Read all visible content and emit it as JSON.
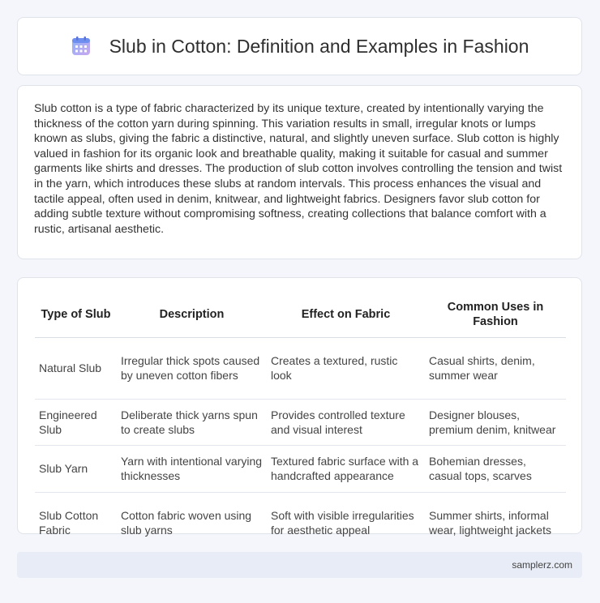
{
  "header": {
    "title": "Slub in Cotton: Definition and Examples in Fashion",
    "icon": "calendar-icon",
    "icon_colors": [
      "#8fb3f7",
      "#c9a7f0"
    ]
  },
  "intro": {
    "text": "Slub cotton is a type of fabric characterized by its unique texture, created by intentionally varying the thickness of the cotton yarn during spinning. This variation results in small, irregular knots or lumps known as slubs, giving the fabric a distinctive, natural, and slightly uneven surface. Slub cotton is highly valued in fashion for its organic look and breathable quality, making it suitable for casual and summer garments like shirts and dresses. The production of slub cotton involves controlling the tension and twist in the yarn, which introduces these slubs at random intervals. This process enhances the visual and tactile appeal, often used in denim, knitwear, and lightweight fabrics. Designers favor slub cotton for adding subtle texture without compromising softness, creating collections that balance comfort with a rustic, artisanal aesthetic."
  },
  "table": {
    "headers": [
      "Type of Slub",
      "Description",
      "Effect on Fabric",
      "Common Uses in Fashion"
    ],
    "rows": [
      [
        "Natural Slub",
        "Irregular thick spots caused by uneven cotton fibers",
        "Creates a textured, rustic look",
        "Casual shirts, denim, summer wear"
      ],
      [
        "Engineered Slub",
        "Deliberate thick yarns spun to create slubs",
        "Provides controlled texture and visual interest",
        "Designer blouses, premium denim, knitwear"
      ],
      [
        "Slub Yarn",
        "Yarn with intentional varying thicknesses",
        "Textured fabric surface with a handcrafted appearance",
        "Bohemian dresses, casual tops, scarves"
      ],
      [
        "Slub Cotton Fabric",
        "Cotton fabric woven using slub yarns",
        "Soft with visible irregularities for aesthetic appeal",
        "Summer shirts, informal wear, lightweight jackets"
      ]
    ]
  },
  "footer": {
    "text": "samplerz.com"
  }
}
